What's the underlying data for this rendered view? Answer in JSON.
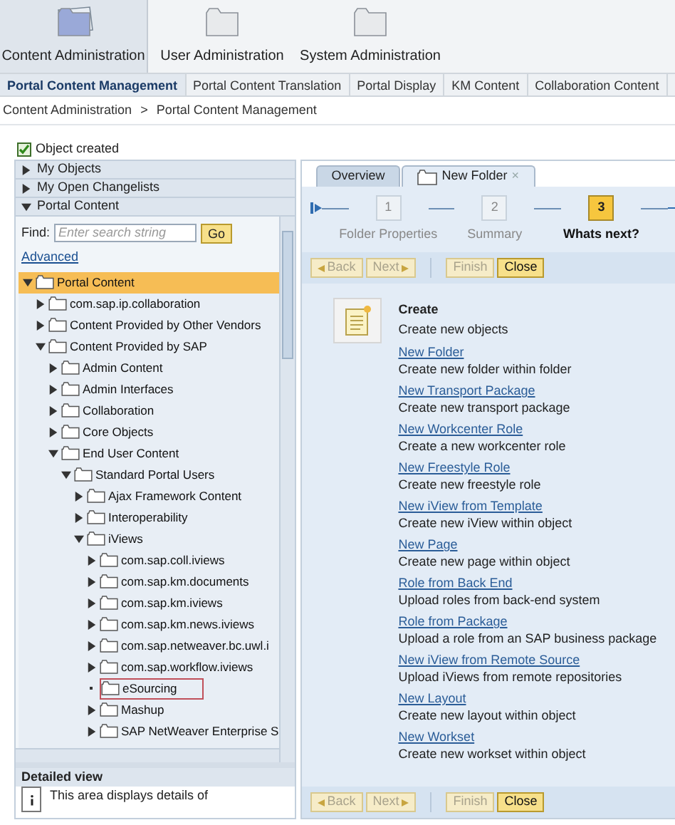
{
  "top_tabs": [
    {
      "label": "Content Administration",
      "selected": true
    },
    {
      "label": "User Administration",
      "selected": false
    },
    {
      "label": "System Administration",
      "selected": false
    }
  ],
  "sub_tabs": [
    {
      "label": "Portal Content Management",
      "selected": true
    },
    {
      "label": "Portal Content Translation",
      "selected": false
    },
    {
      "label": "Portal Display",
      "selected": false
    },
    {
      "label": "KM Content",
      "selected": false
    },
    {
      "label": "Collaboration Content",
      "selected": false
    }
  ],
  "breadcrumb": [
    "Content Administration",
    ">",
    "Portal Content Management"
  ],
  "message": {
    "text": "Object created",
    "checked": true
  },
  "left_panel": {
    "sections": [
      {
        "label": "My Objects",
        "expanded": false
      },
      {
        "label": "My Open Changelists",
        "expanded": false
      },
      {
        "label": "Portal Content",
        "expanded": true
      }
    ],
    "find_label": "Find:",
    "search": {
      "placeholder": "Enter search string"
    },
    "go_button": "Go",
    "advanced_link": "Advanced",
    "tree": [
      {
        "label": "Portal Content",
        "expanded": true,
        "selected": true,
        "outlined": false,
        "children": [
          {
            "label": "com.sap.ip.collaboration",
            "expanded": false,
            "selected": false,
            "outlined": false
          },
          {
            "label": "Content Provided by Other Vendors",
            "expanded": false,
            "selected": false,
            "outlined": false
          },
          {
            "label": "Content Provided by SAP",
            "expanded": true,
            "selected": false,
            "outlined": false,
            "children": [
              {
                "label": "Admin Content",
                "expanded": false,
                "selected": false,
                "outlined": false
              },
              {
                "label": "Admin Interfaces",
                "expanded": false,
                "selected": false,
                "outlined": false
              },
              {
                "label": "Collaboration",
                "expanded": false,
                "selected": false,
                "outlined": false
              },
              {
                "label": "Core Objects",
                "expanded": false,
                "selected": false,
                "outlined": false
              },
              {
                "label": "End User Content",
                "expanded": true,
                "selected": false,
                "outlined": false,
                "children": [
                  {
                    "label": "Standard Portal Users",
                    "expanded": true,
                    "selected": false,
                    "outlined": false,
                    "children": [
                      {
                        "label": "Ajax Framework Content",
                        "expanded": false,
                        "selected": false,
                        "outlined": false
                      },
                      {
                        "label": "Interoperability",
                        "expanded": false,
                        "selected": false,
                        "outlined": false
                      },
                      {
                        "label": "iViews",
                        "expanded": true,
                        "selected": false,
                        "outlined": false,
                        "children": [
                          {
                            "label": "com.sap.coll.iviews",
                            "expanded": false,
                            "selected": false,
                            "outlined": false
                          },
                          {
                            "label": "com.sap.km.documents",
                            "expanded": false,
                            "selected": false,
                            "outlined": false
                          },
                          {
                            "label": "com.sap.km.iviews",
                            "expanded": false,
                            "selected": false,
                            "outlined": false
                          },
                          {
                            "label": "com.sap.km.news.iviews",
                            "expanded": false,
                            "selected": false,
                            "outlined": false
                          },
                          {
                            "label": "com.sap.netweaver.bc.uwl.i",
                            "expanded": false,
                            "selected": false,
                            "outlined": false
                          },
                          {
                            "label": "com.sap.workflow.iviews",
                            "expanded": false,
                            "selected": false,
                            "outlined": false
                          },
                          {
                            "label": "eSourcing",
                            "kind": "leaf",
                            "selected": false,
                            "outlined": true
                          },
                          {
                            "label": "Mashup",
                            "expanded": false,
                            "selected": false,
                            "outlined": false
                          },
                          {
                            "label": "SAP NetWeaver Enterprise S",
                            "expanded": false,
                            "selected": false,
                            "outlined": false
                          }
                        ]
                      }
                    ]
                  }
                ]
              }
            ]
          }
        ]
      }
    ],
    "detail": {
      "title": "Detailed view",
      "text": "This area displays details of"
    }
  },
  "editor_tabs": [
    {
      "label": "Overview",
      "selected": false
    },
    {
      "label": "New Folder",
      "selected": true,
      "close": "×"
    }
  ],
  "roadmap": [
    {
      "number": "1",
      "label": "Folder Properties",
      "selected": false
    },
    {
      "number": "2",
      "label": "Summary",
      "selected": false
    },
    {
      "number": "3",
      "label": "Whats next?",
      "selected": true
    }
  ],
  "toolbar_top": [
    {
      "label": "Back",
      "disabled": true,
      "kind": "back"
    },
    {
      "label": "Next",
      "disabled": true,
      "kind": "next"
    },
    {
      "label": "Finish",
      "disabled": true,
      "kind": "plain"
    },
    {
      "label": "Close",
      "disabled": false,
      "kind": "plain"
    }
  ],
  "create": {
    "title": "Create",
    "subtitle": "Create new objects",
    "items": [
      {
        "link": "New Folder",
        "description": "Create new folder within folder"
      },
      {
        "link": "New Transport Package",
        "description": "Create new transport package"
      },
      {
        "link": "New Workcenter Role",
        "description": "Create a new workcenter role"
      },
      {
        "link": "New Freestyle Role",
        "description": "Create new freestyle role"
      },
      {
        "link": "New iView from Template",
        "description": "Create new iView within object"
      },
      {
        "link": "New Page",
        "description": "Create new page within object"
      },
      {
        "link": "Role from Back End",
        "description": "Upload roles from back-end system"
      },
      {
        "link": "Role from Package",
        "description": "Upload a role from an SAP business package"
      },
      {
        "link": "New iView from Remote Source",
        "description": "Upload iViews from remote repositories"
      },
      {
        "link": "New Layout",
        "description": "Create new layout within object"
      },
      {
        "link": "New Workset",
        "description": "Create new workset within object"
      }
    ]
  },
  "toolbar_bottom": [
    {
      "label": "Back",
      "disabled": true,
      "kind": "back"
    },
    {
      "label": "Next",
      "disabled": true,
      "kind": "next"
    },
    {
      "label": "Finish",
      "disabled": true,
      "kind": "plain"
    },
    {
      "label": "Close",
      "disabled": false,
      "kind": "plain"
    }
  ]
}
